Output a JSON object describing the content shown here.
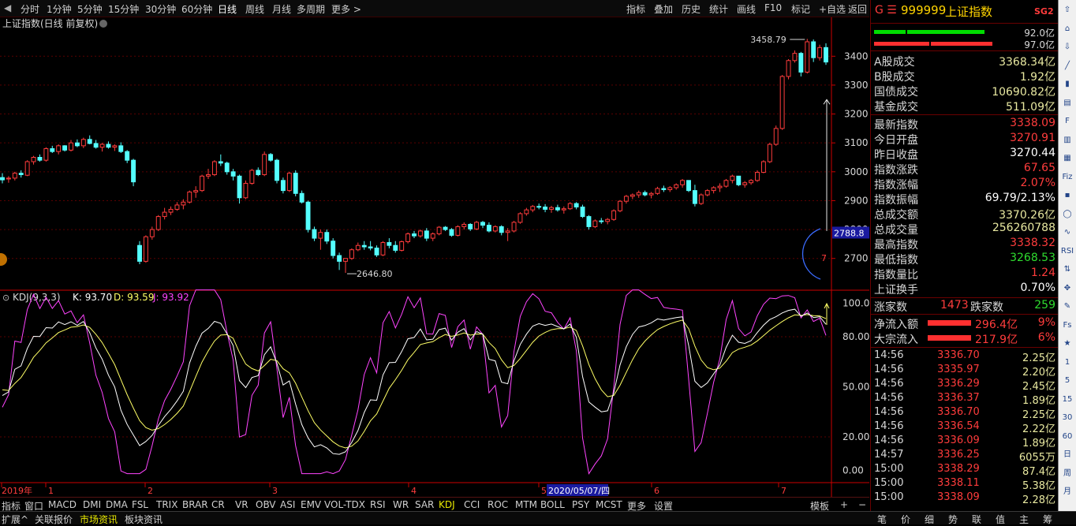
{
  "toolbar": {
    "left": [
      "分时",
      "1分钟",
      "5分钟",
      "15分钟",
      "30分钟",
      "60分钟",
      "日线",
      "周线",
      "月线",
      "多周期",
      "更多 >"
    ],
    "active": "日线",
    "right": [
      "指标",
      "叠加",
      "历史",
      "统计",
      "画线",
      "F10",
      "标记",
      "+自选",
      "返回"
    ]
  },
  "chart_title": "上证指数(日线 前复权)",
  "price_axis": [
    "3400",
    "3300",
    "3200",
    "3100",
    "3000",
    "2900",
    "2800",
    "2700"
  ],
  "price_marker": "2788.8",
  "high_label": "3458.79",
  "low_label": "2646.80",
  "countdown": "7",
  "kdj": {
    "name": "KDJ(9,3,3)",
    "k": "K: 93.70",
    "d": "D: 93.59",
    "j": "J: 93.92"
  },
  "kdj_axis": [
    "100.00",
    "80.00",
    "50.00",
    "20.00",
    "0.00"
  ],
  "date_axis": [
    "2019年",
    "1",
    "2",
    "3",
    "4",
    "5",
    "2020/05/07/四",
    "6",
    "7"
  ],
  "bottom_tabs": [
    "指标",
    "窗口",
    "MACD",
    "DMI",
    "DMA",
    "FSL",
    "TRIX",
    "BRAR",
    "CR",
    "VR",
    "OBV",
    "ASI",
    "EMV",
    "VOL-TDX",
    "RSI",
    "WR",
    "SAR",
    "KDJ",
    "CCI",
    "ROC",
    "MTM",
    "BOLL",
    "PSY",
    "MCST",
    "更多",
    "设置"
  ],
  "bottom_active": "KDJ",
  "bottom_right": [
    "模板",
    "+",
    "−"
  ],
  "status_left": [
    "扩展^",
    "关联报价",
    "市场资讯",
    "板块资讯"
  ],
  "status_active": "市场资讯",
  "status_right": [
    "笔",
    "价",
    "细",
    "势",
    "联",
    "值",
    "主",
    "筹"
  ],
  "panel": {
    "code": "999999",
    "name": "上证指数",
    "badge": "SG2",
    "prefix": "G ☰",
    "bar_top": "92.0亿",
    "bar_bottom": "97.0亿",
    "turnover": [
      {
        "label": "A股成交",
        "value": "3368.34亿"
      },
      {
        "label": "B股成交",
        "value": "1.92亿"
      },
      {
        "label": "国债成交",
        "value": "10690.82亿"
      },
      {
        "label": "基金成交",
        "value": "511.09亿"
      }
    ],
    "stats": [
      {
        "label": "最新指数",
        "value": "3338.09",
        "color": "red"
      },
      {
        "label": "今日开盘",
        "value": "3270.91",
        "color": "red"
      },
      {
        "label": "昨日收盘",
        "value": "3270.44",
        "color": "wht"
      },
      {
        "label": "指数涨跌",
        "value": "67.65",
        "color": "red"
      },
      {
        "label": "指数涨幅",
        "value": "2.07%",
        "color": "red"
      },
      {
        "label": "指数振幅",
        "value": "69.79/2.13%",
        "color": "wht"
      },
      {
        "label": "总成交额",
        "value": "3370.26亿",
        "color": "yel"
      },
      {
        "label": "总成交量",
        "value": "256260788",
        "color": "yel"
      },
      {
        "label": "最高指数",
        "value": "3338.32",
        "color": "red"
      },
      {
        "label": "最低指数",
        "value": "3268.53",
        "color": "green"
      },
      {
        "label": "指数量比",
        "value": "1.24",
        "color": "red"
      },
      {
        "label": "上证换手",
        "value": "0.70%",
        "color": "wht"
      }
    ],
    "updown": {
      "up_label": "涨家数",
      "up": "1473",
      "down_label": "跌家数",
      "down": "259"
    },
    "flows": [
      {
        "label": "净流入额",
        "value": "296.4亿",
        "pct": "9%"
      },
      {
        "label": "大宗流入",
        "value": "217.9亿",
        "pct": "6%"
      }
    ],
    "ticks": [
      {
        "t": "14:56",
        "p": "3336.70",
        "v": "2.25亿"
      },
      {
        "t": "14:56",
        "p": "3335.97",
        "v": "2.20亿"
      },
      {
        "t": "14:56",
        "p": "3336.29",
        "v": "2.45亿"
      },
      {
        "t": "14:56",
        "p": "3336.37",
        "v": "1.89亿"
      },
      {
        "t": "14:56",
        "p": "3336.70",
        "v": "2.25亿"
      },
      {
        "t": "14:56",
        "p": "3336.54",
        "v": "2.22亿"
      },
      {
        "t": "14:56",
        "p": "3336.09",
        "v": "1.89亿"
      },
      {
        "t": "14:57",
        "p": "3336.25",
        "v": "6055万"
      },
      {
        "t": "15:00",
        "p": "3338.29",
        "v": "87.4亿"
      },
      {
        "t": "15:00",
        "p": "3338.11",
        "v": "5.38亿"
      },
      {
        "t": "15:00",
        "p": "3338.09",
        "v": "2.28亿"
      }
    ]
  },
  "icon_bar": [
    "up-arrow-icon",
    "home-icon",
    "down-arrow-icon",
    "line-chart-icon",
    "kline-icon",
    "table-icon",
    "f10-icon",
    "doc-icon",
    "grid-icon",
    "fiz-icon",
    "report-icon",
    "circle-icon",
    "wave-icon",
    "rsi-icon",
    "up-down-icon",
    "move-icon",
    "pencil-icon",
    "fs-icon",
    "fav-icon",
    "num-1",
    "num-5",
    "num-15",
    "num-30",
    "num-60",
    "day-icon",
    "week-icon",
    "month-icon"
  ],
  "icon_labels": [
    "",
    "",
    "",
    "",
    "",
    "",
    "",
    "",
    "",
    "Fiz",
    "",
    "",
    "",
    "RSI",
    "",
    "",
    "",
    "Fs",
    "",
    "1",
    "5",
    "15",
    "30",
    "60",
    "日",
    "周",
    "月"
  ],
  "colors": {
    "up": "#ff3c3c",
    "down": "#54ffff",
    "k_line": "#ffffff",
    "d_line": "#ffff66",
    "j_line": "#ff44ff",
    "grid": "#5a0000",
    "axis": "#cc0000"
  },
  "chart_data": {
    "type": "candlestick",
    "title": "上证指数(日线 前复权)",
    "ylim": [
      2620,
      3480
    ],
    "note_max": "3458.79",
    "note_min": "2646.80",
    "candles": [
      [
        2980,
        2995,
        2960,
        2972
      ],
      [
        2975,
        2985,
        2962,
        2978
      ],
      [
        2978,
        3000,
        2970,
        2995
      ],
      [
        2995,
        3005,
        2980,
        2990
      ],
      [
        2988,
        3040,
        2985,
        3035
      ],
      [
        3035,
        3055,
        3025,
        3050
      ],
      [
        3050,
        3060,
        3035,
        3040
      ],
      [
        3040,
        3085,
        3035,
        3080
      ],
      [
        3080,
        3090,
        3065,
        3070
      ],
      [
        3070,
        3095,
        3060,
        3090
      ],
      [
        3090,
        3092,
        3070,
        3075
      ],
      [
        3075,
        3110,
        3070,
        3100
      ],
      [
        3100,
        3112,
        3085,
        3090
      ],
      [
        3090,
        3118,
        3082,
        3112
      ],
      [
        3112,
        3126,
        3095,
        3098
      ],
      [
        3098,
        3110,
        3080,
        3085
      ],
      [
        3085,
        3100,
        3070,
        3095
      ],
      [
        3095,
        3105,
        3080,
        3085
      ],
      [
        3085,
        3095,
        3072,
        3090
      ],
      [
        3090,
        3102,
        3065,
        3070
      ],
      [
        3070,
        3075,
        3030,
        3040
      ],
      [
        3040,
        3045,
        2950,
        2965
      ],
      [
        2745,
        2760,
        2680,
        2690
      ],
      [
        2690,
        2780,
        2685,
        2775
      ],
      [
        2775,
        2810,
        2765,
        2800
      ],
      [
        2800,
        2850,
        2795,
        2845
      ],
      [
        2845,
        2875,
        2835,
        2860
      ],
      [
        2860,
        2880,
        2850,
        2870
      ],
      [
        2870,
        2895,
        2865,
        2885
      ],
      [
        2885,
        2905,
        2870,
        2895
      ],
      [
        2895,
        2935,
        2890,
        2930
      ],
      [
        2930,
        2950,
        2910,
        2935
      ],
      [
        2935,
        2990,
        2930,
        2985
      ],
      [
        2985,
        3010,
        2975,
        2990
      ],
      [
        2990,
        3040,
        2985,
        3035
      ],
      [
        3035,
        3060,
        3020,
        3030
      ],
      [
        3030,
        3035,
        2990,
        3000
      ],
      [
        3000,
        3010,
        2970,
        2985
      ],
      [
        2985,
        2990,
        2890,
        2910
      ],
      [
        2910,
        2970,
        2905,
        2960
      ],
      [
        2960,
        3010,
        2955,
        3005
      ],
      [
        3005,
        3015,
        2985,
        2990
      ],
      [
        2990,
        3070,
        2985,
        3060
      ],
      [
        3060,
        3065,
        3035,
        3040
      ],
      [
        3040,
        3045,
        2960,
        2970
      ],
      [
        2970,
        2980,
        2925,
        2935
      ],
      [
        2935,
        3000,
        2930,
        2995
      ],
      [
        2995,
        3005,
        2915,
        2925
      ],
      [
        2925,
        2935,
        2890,
        2895
      ],
      [
        2895,
        2900,
        2790,
        2800
      ],
      [
        2800,
        2810,
        2760,
        2770
      ],
      [
        2770,
        2800,
        2730,
        2790
      ],
      [
        2790,
        2800,
        2750,
        2760
      ],
      [
        2760,
        2770,
        2700,
        2710
      ],
      [
        2710,
        2720,
        2660,
        2690
      ],
      [
        2690,
        2700,
        2650,
        2700
      ],
      [
        2700,
        2735,
        2695,
        2730
      ],
      [
        2730,
        2755,
        2725,
        2745
      ],
      [
        2745,
        2760,
        2730,
        2740
      ],
      [
        2740,
        2760,
        2728,
        2736
      ],
      [
        2736,
        2745,
        2705,
        2712
      ],
      [
        2712,
        2760,
        2708,
        2755
      ],
      [
        2755,
        2770,
        2735,
        2745
      ],
      [
        2745,
        2760,
        2720,
        2728
      ],
      [
        2728,
        2762,
        2724,
        2758
      ],
      [
        2758,
        2790,
        2752,
        2785
      ],
      [
        2785,
        2795,
        2770,
        2778
      ],
      [
        2778,
        2800,
        2772,
        2795
      ],
      [
        2795,
        2805,
        2760,
        2770
      ],
      [
        2770,
        2790,
        2760,
        2785
      ],
      [
        2785,
        2812,
        2780,
        2808
      ],
      [
        2808,
        2812,
        2795,
        2800
      ],
      [
        2800,
        2805,
        2775,
        2780
      ],
      [
        2780,
        2815,
        2776,
        2810
      ],
      [
        2810,
        2825,
        2800,
        2818
      ],
      [
        2818,
        2822,
        2795,
        2802
      ],
      [
        2802,
        2830,
        2798,
        2825
      ],
      [
        2825,
        2830,
        2805,
        2815
      ],
      [
        2815,
        2825,
        2790,
        2795
      ],
      [
        2795,
        2815,
        2790,
        2810
      ],
      [
        2810,
        2815,
        2780,
        2790
      ],
      [
        2790,
        2805,
        2760,
        2795
      ],
      [
        2795,
        2830,
        2790,
        2825
      ],
      [
        2825,
        2860,
        2820,
        2855
      ],
      [
        2855,
        2875,
        2848,
        2868
      ],
      [
        2868,
        2885,
        2860,
        2880
      ],
      [
        2880,
        2890,
        2870,
        2878
      ],
      [
        2878,
        2888,
        2860,
        2870
      ],
      [
        2870,
        2882,
        2858,
        2876
      ],
      [
        2876,
        2886,
        2862,
        2868
      ],
      [
        2868,
        2880,
        2855,
        2872
      ],
      [
        2872,
        2895,
        2868,
        2890
      ],
      [
        2890,
        2895,
        2870,
        2878
      ],
      [
        2878,
        2886,
        2840,
        2845
      ],
      [
        2845,
        2850,
        2800,
        2810
      ],
      [
        2810,
        2835,
        2805,
        2830
      ],
      [
        2830,
        2840,
        2820,
        2828
      ],
      [
        2828,
        2840,
        2818,
        2835
      ],
      [
        2835,
        2870,
        2830,
        2865
      ],
      [
        2865,
        2902,
        2860,
        2898
      ],
      [
        2898,
        2920,
        2890,
        2915
      ],
      [
        2915,
        2925,
        2905,
        2920
      ],
      [
        2920,
        2935,
        2910,
        2928
      ],
      [
        2928,
        2935,
        2915,
        2920
      ],
      [
        2920,
        2930,
        2908,
        2925
      ],
      [
        2925,
        2948,
        2920,
        2942
      ],
      [
        2942,
        2952,
        2930,
        2938
      ],
      [
        2938,
        2950,
        2930,
        2945
      ],
      [
        2945,
        2960,
        2938,
        2955
      ],
      [
        2955,
        2975,
        2945,
        2970
      ],
      [
        2970,
        2968,
        2930,
        2935
      ],
      [
        2935,
        2955,
        2880,
        2890
      ],
      [
        2890,
        2925,
        2885,
        2920
      ],
      [
        2920,
        2940,
        2915,
        2935
      ],
      [
        2935,
        2950,
        2925,
        2945
      ],
      [
        2945,
        2960,
        2930,
        2950
      ],
      [
        2950,
        2975,
        2945,
        2970
      ],
      [
        2970,
        2990,
        2960,
        2985
      ],
      [
        2985,
        2978,
        2950,
        2955
      ],
      [
        2955,
        2968,
        2945,
        2962
      ],
      [
        2962,
        2975,
        2955,
        2970
      ],
      [
        2970,
        3005,
        2965,
        2998
      ],
      [
        2998,
        3040,
        2995,
        3035
      ],
      [
        3035,
        3100,
        3030,
        3095
      ],
      [
        3095,
        3160,
        3090,
        3150
      ],
      [
        3150,
        3335,
        3145,
        3330
      ],
      [
        3330,
        3390,
        3320,
        3385
      ],
      [
        3385,
        3420,
        3378,
        3410
      ],
      [
        3410,
        3415,
        3330,
        3345
      ],
      [
        3345,
        3460,
        3340,
        3450
      ],
      [
        3450,
        3458,
        3380,
        3395
      ],
      [
        3395,
        3440,
        3385,
        3430
      ],
      [
        3430,
        3445,
        3370,
        3380
      ]
    ]
  }
}
